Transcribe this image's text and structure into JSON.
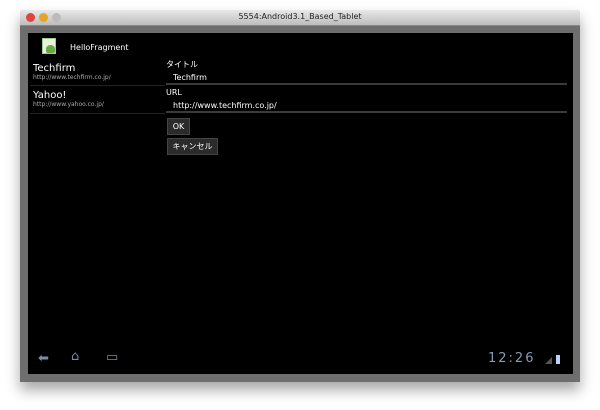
{
  "window": {
    "title": "5554:Android3.1_Based_Tablet"
  },
  "app": {
    "title": "HelloFragment"
  },
  "list": [
    {
      "title": "Techfirm",
      "url": "http://www.techfirm.co.jp/"
    },
    {
      "title": "Yahoo!",
      "url": "http://www.yahoo.co.jp/"
    }
  ],
  "form": {
    "title_label": "タイトル",
    "title_value": "Techfirm",
    "url_label": "URL",
    "url_value": "http://www.techfirm.co.jp/",
    "ok": "OK",
    "cancel": "キャンセル"
  },
  "status": {
    "time": "12:26"
  }
}
